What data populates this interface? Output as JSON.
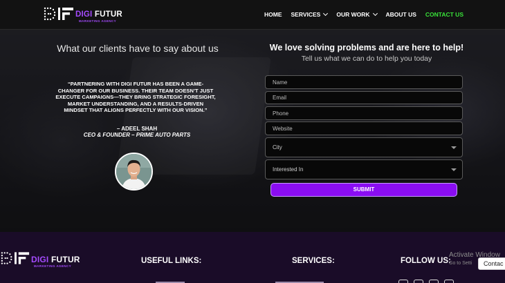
{
  "brand": {
    "name_part1": "DIGI",
    "name_part2": "FUTUR",
    "tagline": "MARKETING AGENCY"
  },
  "nav": {
    "items": [
      {
        "label": "HOME"
      },
      {
        "label": "SERVICES"
      },
      {
        "label": "OUR WORK"
      },
      {
        "label": "ABOUT US"
      },
      {
        "label": "CONTACT US"
      }
    ]
  },
  "testimonial": {
    "heading": "What our clients have to say about us",
    "quote": "“PARTNERING WITH DIGI FUTUR HAS BEEN A GAME-CHANGER FOR OUR BUSINESS. THEIR TEAM DOESN’T JUST EXECUTE CAMPAIGNS—THEY BRING STRATEGIC FORESIGHT, MARKET UNDERSTANDING, AND A RESULTS-DRIVEN MINDSET THAT ALIGNS PERFECTLY WITH OUR VISION.”",
    "author": "– ADEEL SHAH",
    "role": "CEO & FOUNDER – PRIME AUTO PARTS"
  },
  "form": {
    "heading": "We love solving problems and are here to help!",
    "subheading": "Tell us what we can do to help you today",
    "name_placeholder": "Name",
    "email_placeholder": "Email",
    "phone_placeholder": "Phone",
    "website_placeholder": "Website",
    "city_label": "City",
    "interested_label": "Interested In",
    "submit_label": "SUBMIT"
  },
  "footer": {
    "useful_links": "USEFUL LINKS:",
    "services": "SERVICES:",
    "follow_us": "FOLLOW US:"
  },
  "overlay": {
    "activate_title": "Activate Window",
    "activate_sub": "Go to Setti",
    "contact_tab": "Contac"
  },
  "colors": {
    "accent_purple": "#8a0df2",
    "active_nav": "#39e339",
    "footer_bg": "#1a0c28"
  }
}
